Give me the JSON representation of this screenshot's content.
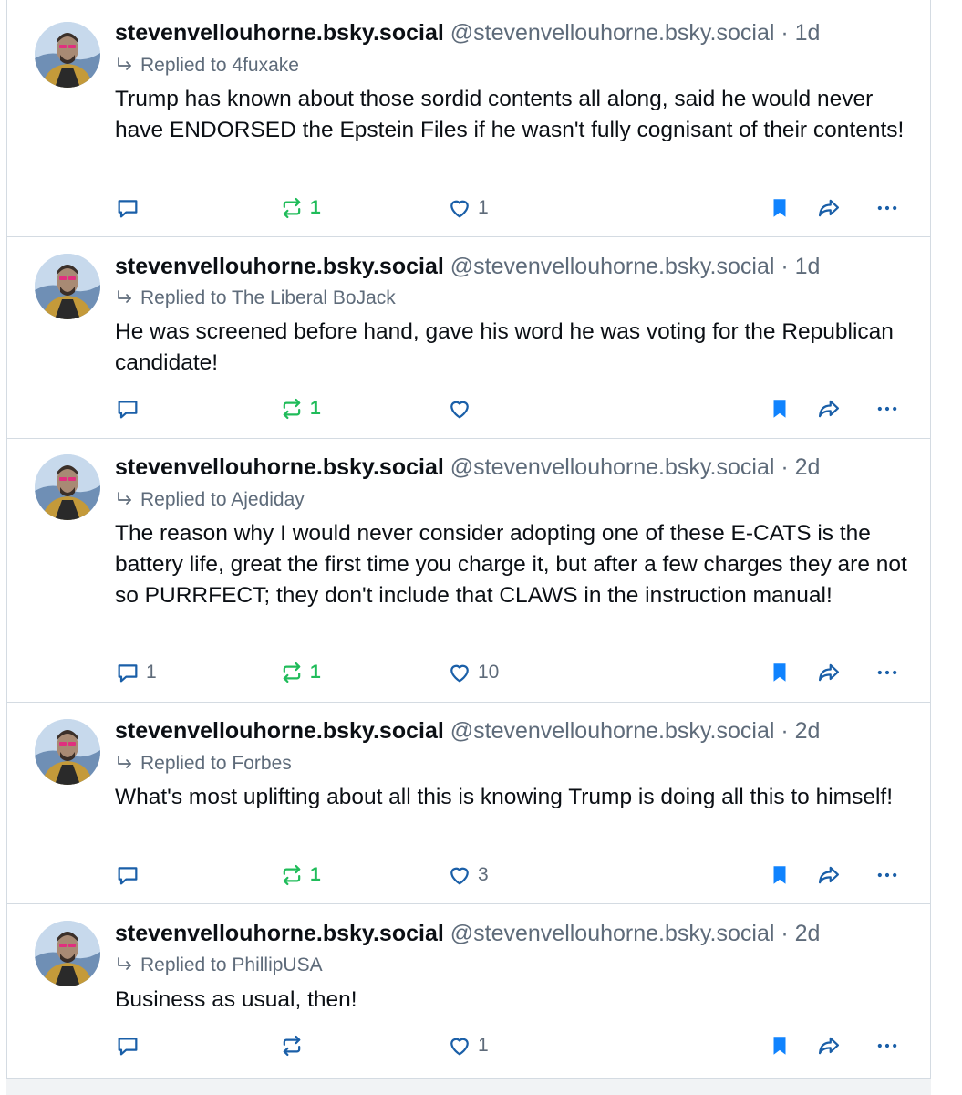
{
  "colors": {
    "accent": "#1083fe",
    "repost_green": "#20bc5a",
    "muted": "#5e6b7a",
    "border": "#d4dbe2"
  },
  "icons": {
    "reply": "speech-bubble-icon",
    "repost": "repost-arrows-icon",
    "like": "heart-icon",
    "bookmark": "bookmark-icon",
    "share": "share-arrow-icon",
    "more": "more-dots-icon",
    "reply_indicator": "reply-arrow-icon"
  },
  "posts": [
    {
      "display_name": "stevenvellouhorne.bsky.social",
      "handle": "@stevenvellouhorne.bsky.social",
      "separator": "·",
      "time": "1d",
      "replied_to": "Replied to 4fuxake",
      "text": "Trump has known about those sordid contents all along, said he would never have ENDORSED the Epstein Files if he wasn't fully cognisant of their contents!",
      "reply_count": "",
      "repost_count": "1",
      "like_count": "1",
      "bookmarked": true
    },
    {
      "display_name": "stevenvellouhorne.bsky.social",
      "handle": "@stevenvellouhorne.bsky.social",
      "separator": "·",
      "time": "1d",
      "replied_to": "Replied to The Liberal BoJack",
      "text": "He was screened before hand, gave his word he was voting for the Republican candidate!",
      "reply_count": "",
      "repost_count": "1",
      "like_count": "",
      "bookmarked": true
    },
    {
      "display_name": "stevenvellouhorne.bsky.social",
      "handle": "@stevenvellouhorne.bsky.social",
      "separator": "·",
      "time": "2d",
      "replied_to": "Replied to Ajediday",
      "text": "The reason why I would never consider adopting one of these E-CATS is the battery life, great the first time you charge it, but after a few charges they are not so PURRFECT; they don't include that CLAWS in the instruction manual!",
      "reply_count": "1",
      "repost_count": "1",
      "like_count": "10",
      "bookmarked": true
    },
    {
      "display_name": "stevenvellouhorne.bsky.social",
      "handle": "@stevenvellouhorne.bsky.social",
      "separator": "·",
      "time": "2d",
      "replied_to": "Replied to Forbes",
      "text": "What's most uplifting about all this is knowing Trump is doing all this to himself!",
      "reply_count": "",
      "repost_count": "1",
      "like_count": "3",
      "bookmarked": true
    },
    {
      "display_name": "stevenvellouhorne.bsky.social",
      "handle": "@stevenvellouhorne.bsky.social",
      "separator": "·",
      "time": "2d",
      "replied_to": "Replied to PhillipUSA",
      "text": "Business as usual, then!",
      "reply_count": "",
      "repost_count": "",
      "like_count": "1",
      "bookmarked": true
    }
  ]
}
